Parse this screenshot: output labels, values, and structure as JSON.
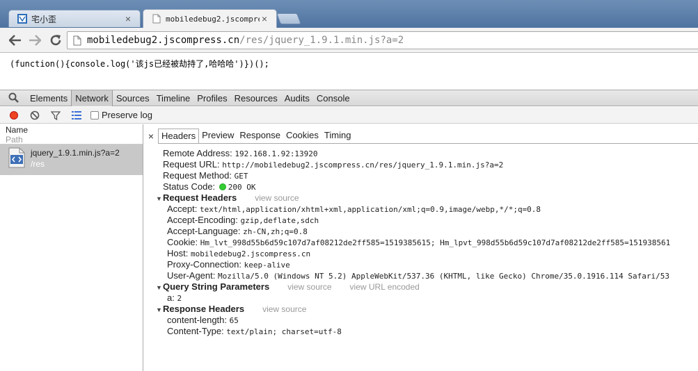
{
  "tabs": [
    {
      "title": "宅小歪",
      "close": "×"
    },
    {
      "title": "mobiledebug2.jscompress",
      "close": "×"
    }
  ],
  "toolbar": {
    "url_host": "mobiledebug2.jscompress.cn",
    "url_path": "/res/jquery_1.9.1.min.js?a=2"
  },
  "page": {
    "code": "(function(){console.log('该js已经被劫持了,哈哈哈')})();"
  },
  "devtools": {
    "tabs": [
      "Elements",
      "Network",
      "Sources",
      "Timeline",
      "Profiles",
      "Resources",
      "Audits",
      "Console"
    ],
    "selected_tab": "Network",
    "preserve_log": "Preserve log",
    "list": {
      "col_name": "Name",
      "col_path": "Path",
      "request_name": "jquery_1.9.1.min.js?a=2",
      "request_path": "/res"
    },
    "subtabs": [
      "Headers",
      "Preview",
      "Response",
      "Cookies",
      "Timing"
    ],
    "selected_subtab": "Headers",
    "general": [
      {
        "k": "Remote Address:",
        "v": "192.168.1.92:13920"
      },
      {
        "k": "Request URL:",
        "v": "http://mobiledebug2.jscompress.cn/res/jquery_1.9.1.min.js?a=2"
      },
      {
        "k": "Request Method:",
        "v": "GET"
      }
    ],
    "status": {
      "k": "Status Code:",
      "v": "200 OK"
    },
    "request_headers": {
      "title": "Request Headers",
      "view_source": "view source",
      "items": [
        {
          "k": "Accept:",
          "v": "text/html,application/xhtml+xml,application/xml;q=0.9,image/webp,*/*;q=0.8"
        },
        {
          "k": "Accept-Encoding:",
          "v": "gzip,deflate,sdch"
        },
        {
          "k": "Accept-Language:",
          "v": "zh-CN,zh;q=0.8"
        },
        {
          "k": "Cookie:",
          "v": "Hm_lvt_998d55b6d59c107d7af08212de2ff585=1519385615; Hm_lpvt_998d55b6d59c107d7af08212de2ff585=151938561"
        },
        {
          "k": "Host:",
          "v": "mobiledebug2.jscompress.cn"
        },
        {
          "k": "Proxy-Connection:",
          "v": "keep-alive"
        },
        {
          "k": "User-Agent:",
          "v": "Mozilla/5.0 (Windows NT 5.2) AppleWebKit/537.36 (KHTML, like Gecko) Chrome/35.0.1916.114 Safari/53"
        }
      ]
    },
    "query": {
      "title": "Query String Parameters",
      "view_source": "view source",
      "view_encoded": "view URL encoded",
      "items": [
        {
          "k": "a:",
          "v": "2"
        }
      ]
    },
    "response_headers": {
      "title": "Response Headers",
      "view_source": "view source",
      "items": [
        {
          "k": "content-length:",
          "v": "65"
        },
        {
          "k": "Content-Type:",
          "v": "text/plain; charset=utf-8"
        }
      ]
    }
  },
  "colors": {
    "status_ok": "#33cc33",
    "record": "#ee4422",
    "selected_row": "#c8c8c8"
  }
}
